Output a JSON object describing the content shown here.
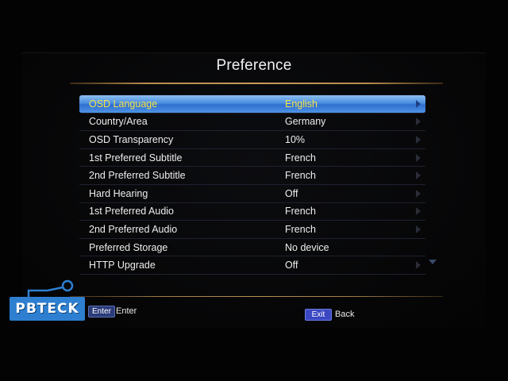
{
  "title": "Preference",
  "menu": [
    {
      "label": "OSD Language",
      "value": "English",
      "selected": true,
      "arrow": true
    },
    {
      "label": "Country/Area",
      "value": "Germany",
      "selected": false,
      "arrow": true
    },
    {
      "label": "OSD Transparency",
      "value": "10%",
      "selected": false,
      "arrow": true
    },
    {
      "label": "1st Preferred Subtitle",
      "value": "French",
      "selected": false,
      "arrow": true
    },
    {
      "label": "2nd Preferred Subtitle",
      "value": "French",
      "selected": false,
      "arrow": true
    },
    {
      "label": "Hard Hearing",
      "value": "Off",
      "selected": false,
      "arrow": true
    },
    {
      "label": "1st Preferred Audio",
      "value": "French",
      "selected": false,
      "arrow": true
    },
    {
      "label": "2nd Preferred Audio",
      "value": "French",
      "selected": false,
      "arrow": true
    },
    {
      "label": "Preferred Storage",
      "value": "No device",
      "selected": false,
      "arrow": false
    },
    {
      "label": "HTTP Upgrade",
      "value": "Off",
      "selected": false,
      "arrow": true
    }
  ],
  "footer": {
    "enter_key": "Enter",
    "enter_label": "Enter",
    "exit_key": "Exit",
    "exit_label": "Back"
  },
  "watermark": "PBTECK",
  "colors": {
    "selected_text": "#f5e24a",
    "selected_bar": "#4a8ee0",
    "accent_rule": "#c99a58",
    "logo": "#2e7fd0"
  }
}
